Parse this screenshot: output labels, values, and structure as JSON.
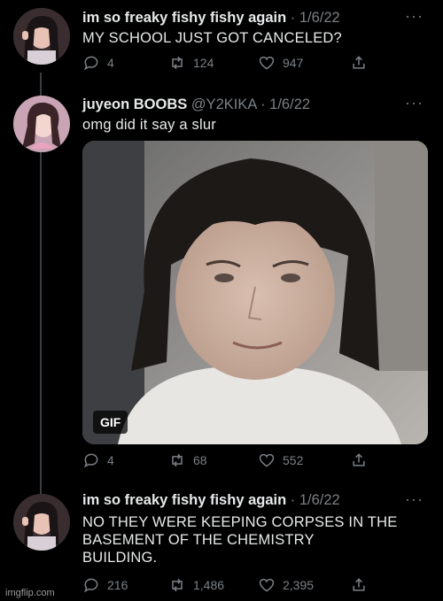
{
  "tweets": [
    {
      "name": "im so freaky fishy fishy again",
      "handle": "",
      "dot": "·",
      "date": "1/6/22",
      "text": "MY SCHOOL JUST GOT CANCELED?",
      "replies": "4",
      "retweets": "124",
      "likes": "947"
    },
    {
      "name": "juyeon BOOBS",
      "handle": "@Y2KIKA",
      "dot": "·",
      "date": "1/6/22",
      "text": "omg did it say a slur",
      "media_badge": "GIF",
      "replies": "4",
      "retweets": "68",
      "likes": "552"
    },
    {
      "name": "im so freaky fishy fishy again",
      "handle": "",
      "dot": "·",
      "date": "1/6/22",
      "text_lines": [
        "NO THEY WERE KEEPING CORPSES IN THE",
        "BASEMENT OF THE CHEMISTRY",
        "BUILDING."
      ],
      "replies": "216",
      "retweets": "1,486",
      "likes": "2,395"
    }
  ],
  "more_glyph": "···",
  "watermark": "imgflip.com",
  "icons": {
    "reply": "reply-icon",
    "retweet": "retweet-icon",
    "like": "heart-icon",
    "share": "share-icon",
    "more": "more-icon"
  },
  "colors": {
    "background": "#000000",
    "text": "#e7e9ea",
    "muted": "#7b8085"
  }
}
